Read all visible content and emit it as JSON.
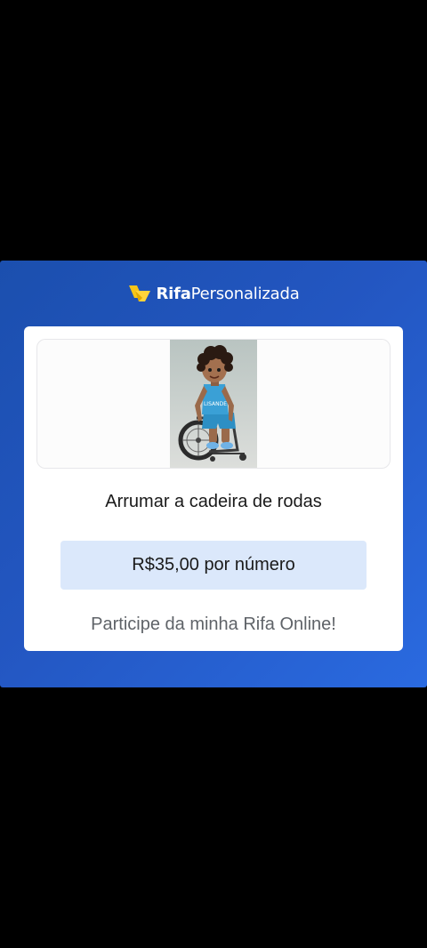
{
  "brand": {
    "name_bold": "Rifa",
    "name_regular": "Personalizada",
    "logo_icon": "ticket-logo-icon",
    "logo_color": "#f5c518"
  },
  "raffle": {
    "title": "Arrumar a cadeira de rodas",
    "image_icon": "boy-in-wheelchair-illustration",
    "jersey_text": "LISANDE",
    "price_label": "R$35,00 por número",
    "call_to_action": "Participe da minha Rifa Online!"
  },
  "colors": {
    "background": "#000000",
    "card_gradient_start": "#1b4fae",
    "card_gradient_end": "#2a6ae0",
    "price_bg": "#dbe8fb"
  }
}
